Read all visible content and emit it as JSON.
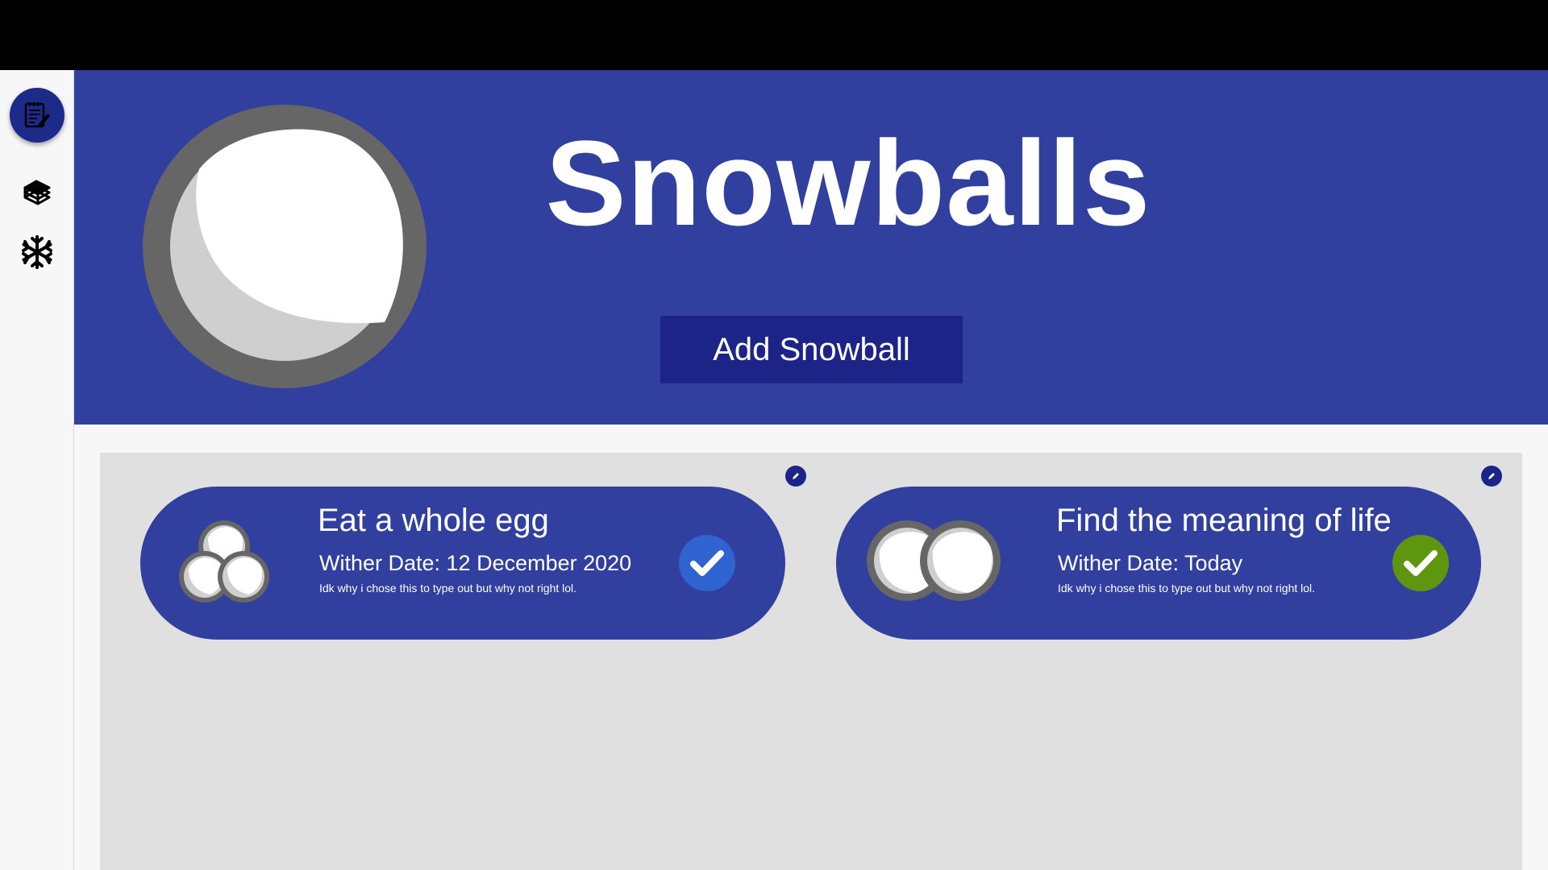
{
  "header": {
    "title": "Snowballs",
    "add_button_label": "Add Snowball"
  },
  "sidebar": {
    "items": [
      {
        "icon": "notepad-edit-icon",
        "active": true
      },
      {
        "icon": "books-icon",
        "active": false
      },
      {
        "icon": "snowflake-icon",
        "active": false
      }
    ]
  },
  "snowballs": [
    {
      "title": "Eat a whole egg",
      "wither_date": "Wither Date: 12 December 2020",
      "description": "Idk why i chose this to type out but why not right lol.",
      "icon": "three-snowballs-icon",
      "check_color": "#2e63d0"
    },
    {
      "title": "Find the meaning of life",
      "wither_date": "Wither Date: Today",
      "description": "Idk why i chose this to type out but why not right lol.",
      "icon": "two-snowballs-icon",
      "check_color": "#5e9610"
    }
  ],
  "colors": {
    "primary": "#313f9f",
    "primary_dark": "#1c2587",
    "top_bar": "#000000",
    "content_bg": "#e0e0e0"
  }
}
